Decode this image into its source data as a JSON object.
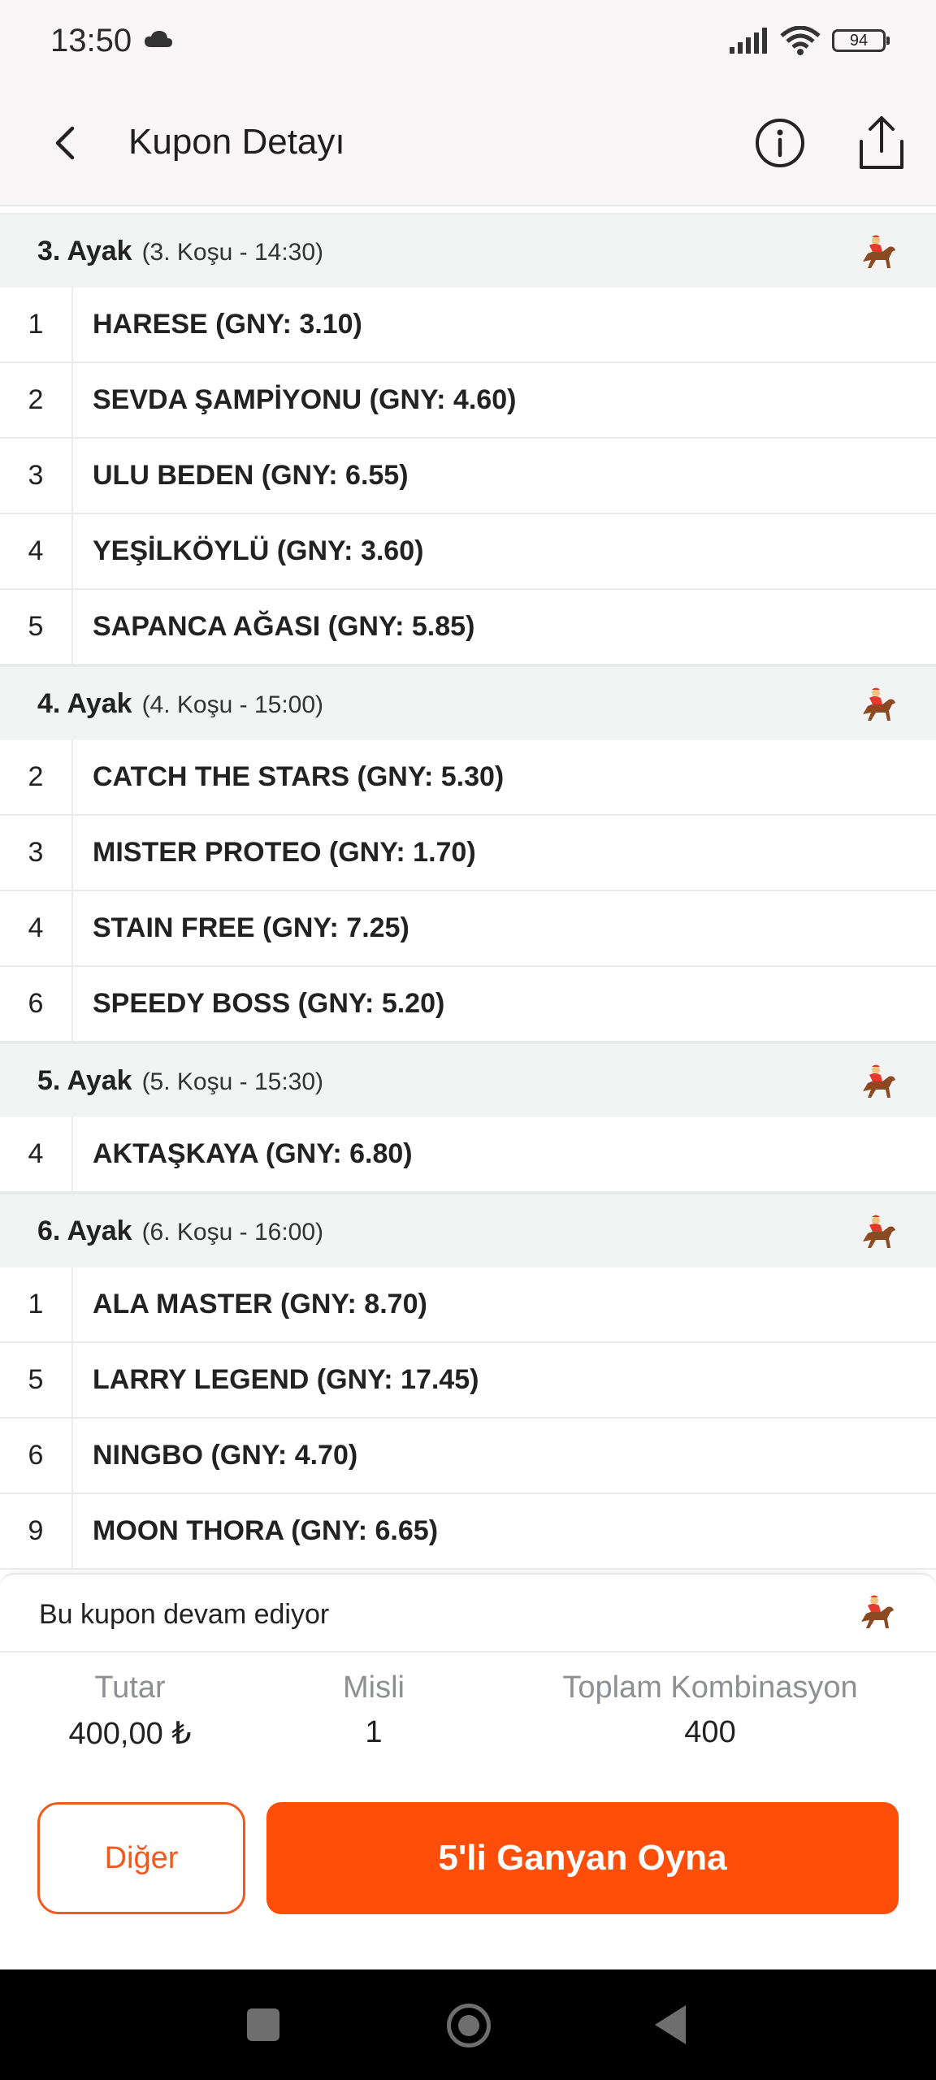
{
  "status_bar": {
    "time": "13:50",
    "battery": "94"
  },
  "header": {
    "title": "Kupon Detayı"
  },
  "legs": [
    {
      "title": "3. Ayak",
      "subtitle": "(3. Koşu - 14:30)",
      "runners": [
        {
          "no": "1",
          "name": "HARESE (GNY: 3.10)"
        },
        {
          "no": "2",
          "name": "SEVDA ŞAMPİYONU (GNY: 4.60)"
        },
        {
          "no": "3",
          "name": "ULU BEDEN (GNY: 6.55)"
        },
        {
          "no": "4",
          "name": "YEŞİLKÖYLÜ (GNY: 3.60)"
        },
        {
          "no": "5",
          "name": "SAPANCA AĞASI (GNY: 5.85)"
        }
      ]
    },
    {
      "title": "4. Ayak",
      "subtitle": "(4. Koşu - 15:00)",
      "runners": [
        {
          "no": "2",
          "name": "CATCH THE STARS (GNY: 5.30)"
        },
        {
          "no": "3",
          "name": "MISTER PROTEO (GNY: 1.70)"
        },
        {
          "no": "4",
          "name": "STAIN FREE (GNY: 7.25)"
        },
        {
          "no": "6",
          "name": "SPEEDY BOSS (GNY: 5.20)"
        }
      ]
    },
    {
      "title": "5. Ayak",
      "subtitle": "(5. Koşu - 15:30)",
      "runners": [
        {
          "no": "4",
          "name": "AKTAŞKAYA (GNY: 6.80)"
        }
      ]
    },
    {
      "title": "6. Ayak",
      "subtitle": "(6. Koşu - 16:00)",
      "runners": [
        {
          "no": "1",
          "name": "ALA MASTER (GNY: 8.70)"
        },
        {
          "no": "5",
          "name": "LARRY LEGEND (GNY: 17.45)"
        },
        {
          "no": "6",
          "name": "NINGBO (GNY: 4.70)"
        },
        {
          "no": "9",
          "name": "MOON THORA (GNY: 6.65)"
        }
      ]
    }
  ],
  "coupon_status": {
    "text": "Bu kupon devam ediyor"
  },
  "summary": {
    "amount_label": "Tutar",
    "amount_value": "400,00 ₺",
    "multiplier_label": "Misli",
    "multiplier_value": "1",
    "combination_label": "Toplam Kombinasyon",
    "combination_value": "400"
  },
  "actions": {
    "other_label": "Diğer",
    "play_label": "5'li Ganyan Oyna"
  },
  "colors": {
    "accent": "#ff4e0a",
    "leg_header_bg": "#f2f4f4"
  }
}
